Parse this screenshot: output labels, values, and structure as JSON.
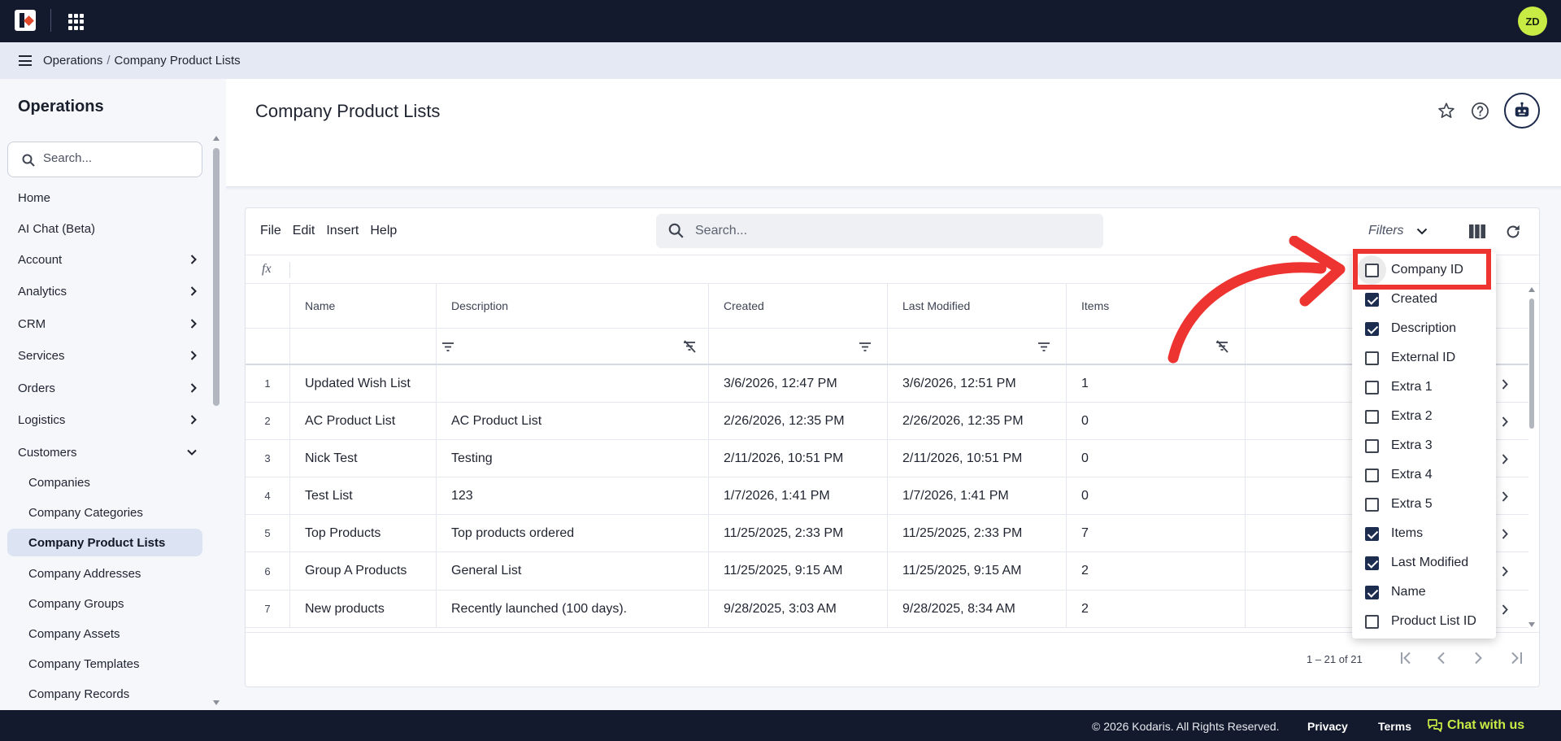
{
  "topbar": {
    "user_initials": "ZD"
  },
  "breadcrumb": {
    "section": "Operations",
    "page": "Company Product Lists"
  },
  "sidebar": {
    "title": "Operations",
    "search_placeholder": "Search...",
    "items": [
      {
        "label": "Home"
      },
      {
        "label": "AI Chat (Beta)"
      },
      {
        "label": "Account"
      },
      {
        "label": "Analytics"
      },
      {
        "label": "CRM"
      },
      {
        "label": "Services"
      },
      {
        "label": "Orders"
      },
      {
        "label": "Logistics"
      },
      {
        "label": "Customers"
      }
    ],
    "customers_sub": [
      {
        "label": "Companies"
      },
      {
        "label": "Company Categories"
      },
      {
        "label": "Company Product Lists"
      },
      {
        "label": "Company Addresses"
      },
      {
        "label": "Company Groups"
      },
      {
        "label": "Company Assets"
      },
      {
        "label": "Company Templates"
      },
      {
        "label": "Company Records"
      }
    ]
  },
  "main": {
    "title": "Company Product Lists",
    "menu": [
      "File",
      "Edit",
      "Insert",
      "Help"
    ],
    "search_placeholder": "Search...",
    "filters_label": "Filters",
    "fx_label": "fx"
  },
  "table": {
    "columns": [
      "Name",
      "Description",
      "Created",
      "Last Modified",
      "Items"
    ],
    "rows": [
      {
        "n": "1",
        "name": "Updated Wish List",
        "description": "",
        "created": "3/6/2026, 12:47 PM",
        "modified": "3/6/2026, 12:51 PM",
        "items": "1"
      },
      {
        "n": "2",
        "name": "AC Product List",
        "description": "AC Product List",
        "created": "2/26/2026, 12:35 PM",
        "modified": "2/26/2026, 12:35 PM",
        "items": "0"
      },
      {
        "n": "3",
        "name": "Nick Test",
        "description": "Testing",
        "created": "2/11/2026, 10:51 PM",
        "modified": "2/11/2026, 10:51 PM",
        "items": "0"
      },
      {
        "n": "4",
        "name": "Test List",
        "description": "123",
        "created": "1/7/2026, 1:41 PM",
        "modified": "1/7/2026, 1:41 PM",
        "items": "0"
      },
      {
        "n": "5",
        "name": "Top Products",
        "description": "Top products ordered",
        "created": "11/25/2025, 2:33 PM",
        "modified": "11/25/2025, 2:33 PM",
        "items": "7"
      },
      {
        "n": "6",
        "name": "Group A Products",
        "description": "General List",
        "created": "11/25/2025, 9:15 AM",
        "modified": "11/25/2025, 9:15 AM",
        "items": "2"
      },
      {
        "n": "7",
        "name": "New products",
        "description": "Recently launched (100 days).",
        "created": "9/28/2025, 3:03 AM",
        "modified": "9/28/2025, 8:34 AM",
        "items": "2"
      }
    ],
    "pager_range": "1 – 21 of 21"
  },
  "column_picker": {
    "options": [
      {
        "label": "Company ID",
        "checked": false
      },
      {
        "label": "Created",
        "checked": true
      },
      {
        "label": "Description",
        "checked": true
      },
      {
        "label": "External ID",
        "checked": false
      },
      {
        "label": "Extra 1",
        "checked": false
      },
      {
        "label": "Extra 2",
        "checked": false
      },
      {
        "label": "Extra 3",
        "checked": false
      },
      {
        "label": "Extra 4",
        "checked": false
      },
      {
        "label": "Extra 5",
        "checked": false
      },
      {
        "label": "Items",
        "checked": true
      },
      {
        "label": "Last Modified",
        "checked": true
      },
      {
        "label": "Name",
        "checked": true
      },
      {
        "label": "Product List ID",
        "checked": false
      }
    ]
  },
  "footer": {
    "copyright": "© 2026 Kodaris. All Rights Reserved.",
    "privacy": "Privacy",
    "terms": "Terms",
    "chat": "Chat with us"
  },
  "colors": {
    "navy": "#131a2e",
    "accent_lime": "#c9ec44",
    "annotation_red": "#ee3431",
    "checkbox_checked": "#1c2d4f"
  }
}
